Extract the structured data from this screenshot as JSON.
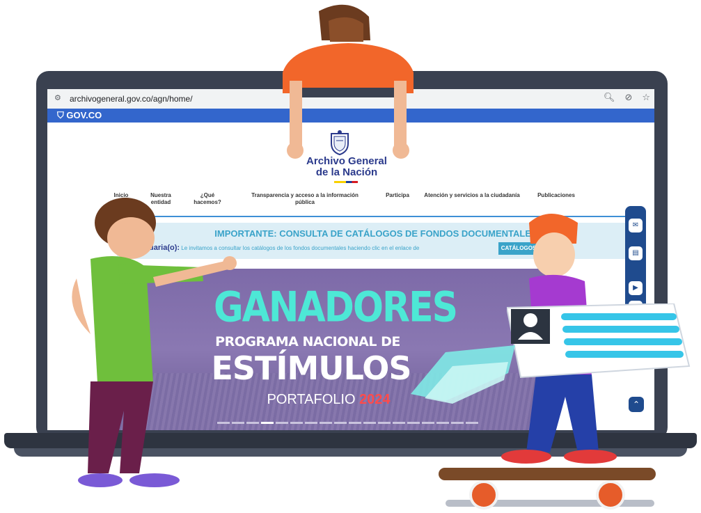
{
  "browser": {
    "url": "archivogeneral.gov.co/agn/home/"
  },
  "gov_bar": {
    "logo": "GOV.CO"
  },
  "header": {
    "org_line1": "Archivo General",
    "org_line2": "de la Nación"
  },
  "nav": {
    "items": [
      {
        "label": "Inicio"
      },
      {
        "label": "Nuestra entidad"
      },
      {
        "label": "¿Qué hacemos?"
      },
      {
        "label": "Transparencia y acceso a la información pública"
      },
      {
        "label": "Participa"
      },
      {
        "label": "Atención y servicios a la ciudadanía"
      },
      {
        "label": "Publicaciones"
      }
    ]
  },
  "notice": {
    "title": "IMPORTANTE: CONSULTA DE CATÁLOGOS DE FONDOS DOCUMENTALES",
    "greeting": "a(o) usuaria(o):",
    "body": "Le invitamos a consultar los catálogos de los fondos documentales haciendo clic en el enlace de",
    "button": "CATÁLOGOS"
  },
  "banner": {
    "line1": "GANADORES",
    "line2": "PROGRAMA NACIONAL DE",
    "line3": "ESTÍMULOS",
    "line4_prefix": "PORTAFOLIO ",
    "line4_year": "2024"
  },
  "colors": {
    "gov_blue": "#3366cc",
    "accent_teal": "#3aa3c9",
    "banner_title": "#4de8d6",
    "side_bar": "#1f4b8e"
  }
}
